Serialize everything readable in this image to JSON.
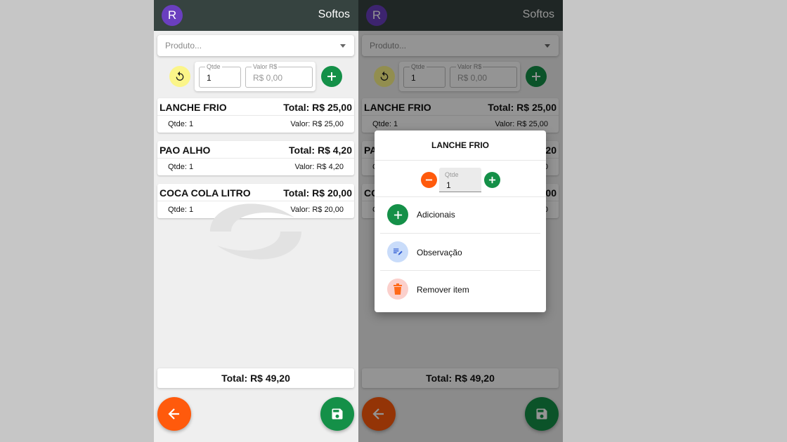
{
  "app": {
    "brand": "Softos",
    "avatar_letter": "R"
  },
  "product": {
    "placeholder": "Produto..."
  },
  "entry": {
    "qtde_label": "Qtde",
    "qtde_value": "1",
    "valor_label": "Valor R$",
    "valor_value": "R$ 0,00"
  },
  "items": [
    {
      "name": "LANCHE FRIO",
      "total": "Total: R$ 25,00",
      "qtde": "Qtde: 1",
      "valor": "Valor: R$ 25,00"
    },
    {
      "name": "PAO ALHO",
      "total": "Total: R$ 4,20",
      "qtde": "Qtde: 1",
      "valor": "Valor: R$ 4,20"
    },
    {
      "name": "COCA COLA LITRO",
      "total": "Total: R$ 20,00",
      "qtde": "Qtde: 1",
      "valor": "Valor: R$ 20,00"
    }
  ],
  "order_total": "Total: R$ 49,20",
  "dialog": {
    "title": "LANCHE FRIO",
    "qtde_label": "Qtde",
    "qtde_value": "1",
    "options": [
      {
        "label": "Adicionais",
        "icon": "plus-icon"
      },
      {
        "label": "Observação",
        "icon": "note-edit-icon"
      },
      {
        "label": "Remover item",
        "icon": "trash-icon"
      }
    ]
  },
  "colors": {
    "appbar": "#364340",
    "avatar": "#6a3fbf",
    "primary_green": "#149048",
    "accent_orange": "#ff5a0c",
    "refresh_yellow": "#fbf589",
    "note_blue_bg": "#c9dcfa",
    "remove_red_bg": "#fbd0cc"
  }
}
